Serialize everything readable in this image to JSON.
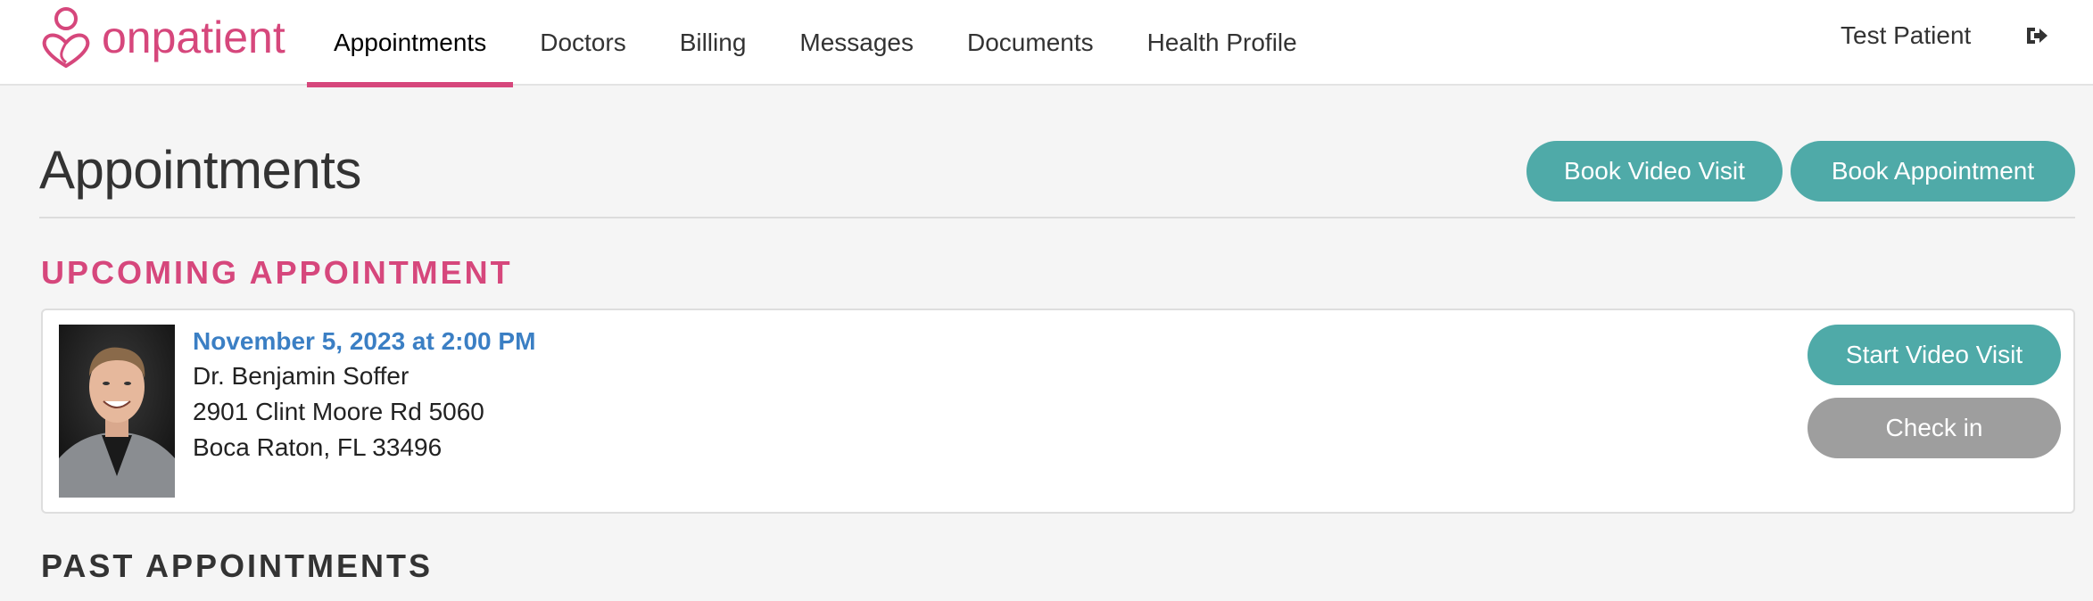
{
  "brand": {
    "name": "onpatient",
    "accent": "#d6477c",
    "teal": "#4faaa8"
  },
  "nav": {
    "tabs": [
      {
        "label": "Appointments",
        "active": true
      },
      {
        "label": "Doctors"
      },
      {
        "label": "Billing"
      },
      {
        "label": "Messages"
      },
      {
        "label": "Documents"
      },
      {
        "label": "Health Profile"
      }
    ],
    "user_name": "Test Patient",
    "logout_icon": "logout-icon"
  },
  "page": {
    "title": "Appointments",
    "book_video_label": "Book Video Visit",
    "book_appointment_label": "Book Appointment"
  },
  "upcoming": {
    "heading": "UPCOMING APPOINTMENT",
    "date": "November 5, 2023 at 2:00 PM",
    "doctor": "Dr. Benjamin Soffer",
    "address_line1": "2901 Clint Moore Rd 5060",
    "address_line2": "Boca Raton, FL 33496",
    "start_video_label": "Start Video Visit",
    "check_in_label": "Check in"
  },
  "past": {
    "heading": "PAST APPOINTMENTS"
  }
}
